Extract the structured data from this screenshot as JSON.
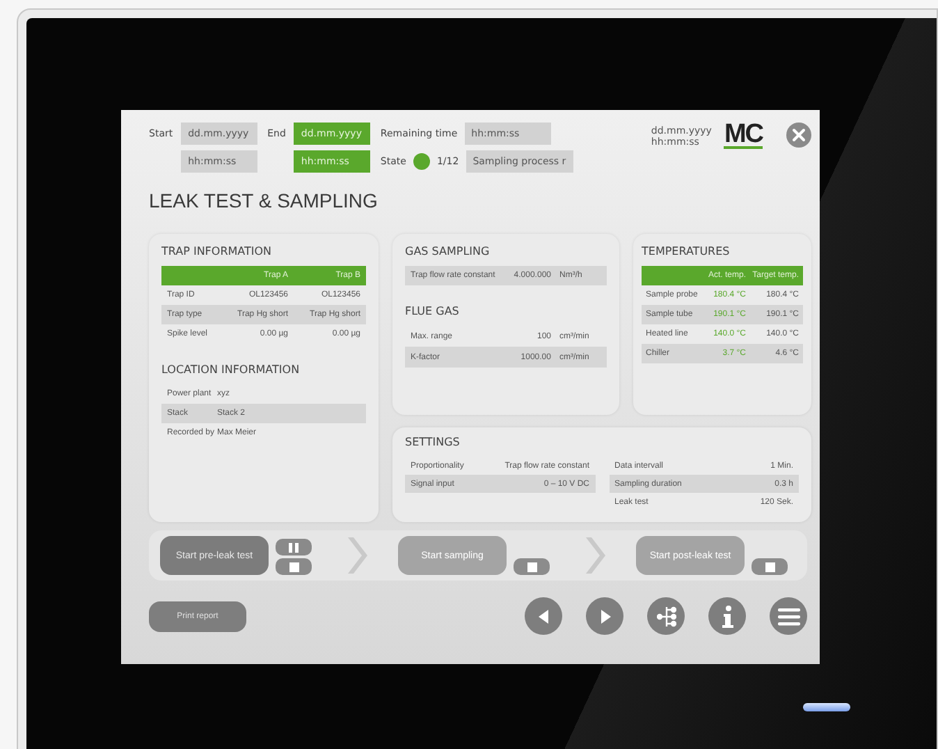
{
  "header": {
    "start": {
      "label": "Start",
      "date": "dd.mm.yyyy",
      "time": "hh:mm:ss",
      "highlighted": false
    },
    "end": {
      "label": "End",
      "date": "dd.mm.yyyy",
      "time": "hh:mm:ss",
      "highlighted": true
    },
    "remaining": {
      "label": "Remaining time",
      "value": "hh:mm:ss"
    },
    "state": {
      "label": "State",
      "color": "#5aa82c",
      "step": "1/12",
      "value": "Sampling process r"
    },
    "datetime": {
      "date": "dd.mm.yyyy",
      "time": "hh:mm:ss"
    },
    "logo": "MC"
  },
  "title": "LEAK TEST & SAMPLING",
  "trap_information": {
    "title": "TRAP INFORMATION",
    "columns": [
      "Trap A",
      "Trap B"
    ],
    "rows": [
      {
        "label": "Trap ID",
        "values": [
          "OL123456",
          "OL123456"
        ]
      },
      {
        "label": "Trap type",
        "values": [
          "Trap Hg short",
          "Trap Hg short"
        ]
      },
      {
        "label": "Spike level",
        "values": [
          "0.00 µg",
          "0.00 µg"
        ]
      }
    ]
  },
  "location_information": {
    "title": "LOCATION INFORMATION",
    "rows": [
      {
        "label": "Power plant",
        "value": "xyz"
      },
      {
        "label": "Stack",
        "value": "Stack 2"
      },
      {
        "label": "Recorded by",
        "value": "Max Meier"
      }
    ]
  },
  "gas_sampling": {
    "title": "GAS SAMPLING",
    "rows": [
      {
        "label": "Trap flow rate constant",
        "value": "4.000.000",
        "unit": "Nm³/h"
      }
    ]
  },
  "flue_gas": {
    "title": "FLUE GAS",
    "rows": [
      {
        "label": "Max. range",
        "value": "100",
        "unit": "cm³/min"
      },
      {
        "label": "K-factor",
        "value": "1000.00",
        "unit": "cm³/min"
      }
    ]
  },
  "temperatures": {
    "title": "TEMPERATURES",
    "columns": [
      "Act. temp.",
      "Target temp."
    ],
    "rows": [
      {
        "label": "Sample probe",
        "actual": "180.4 °C",
        "target": "180.4 °C"
      },
      {
        "label": "Sample tube",
        "actual": "190.1 °C",
        "target": "190.1 °C"
      },
      {
        "label": "Heated line",
        "actual": "140.0 °C",
        "target": "140.0 °C"
      },
      {
        "label": "Chiller",
        "actual": "3.7 °C",
        "target": "4.6 °C"
      }
    ]
  },
  "settings": {
    "title": "SETTINGS",
    "left": [
      {
        "label": "Proportionality",
        "value": "Trap flow rate constant"
      },
      {
        "label": "Signal input",
        "value": "0 – 10 V DC"
      }
    ],
    "right": [
      {
        "label": "Data intervall",
        "value": "1 Min."
      },
      {
        "label": "Sampling duration",
        "value": "0.3 h"
      },
      {
        "label": "Leak test",
        "value": "120 Sek."
      }
    ]
  },
  "process": [
    {
      "label": "Start pre-leak test",
      "disabled": false,
      "controls": [
        {
          "kind": "pause"
        },
        {
          "kind": "stop"
        }
      ]
    },
    {
      "label": "Start sampling",
      "disabled": true,
      "controls": [
        {
          "kind": "stop"
        }
      ]
    },
    {
      "label": "Start post-leak test",
      "disabled": true,
      "controls": [
        {
          "kind": "stop"
        }
      ]
    }
  ],
  "print_button": "Print report",
  "nav_buttons": [
    {
      "kind": "back"
    },
    {
      "kind": "forward"
    },
    {
      "kind": "tree"
    },
    {
      "kind": "info"
    },
    {
      "kind": "menu"
    }
  ]
}
